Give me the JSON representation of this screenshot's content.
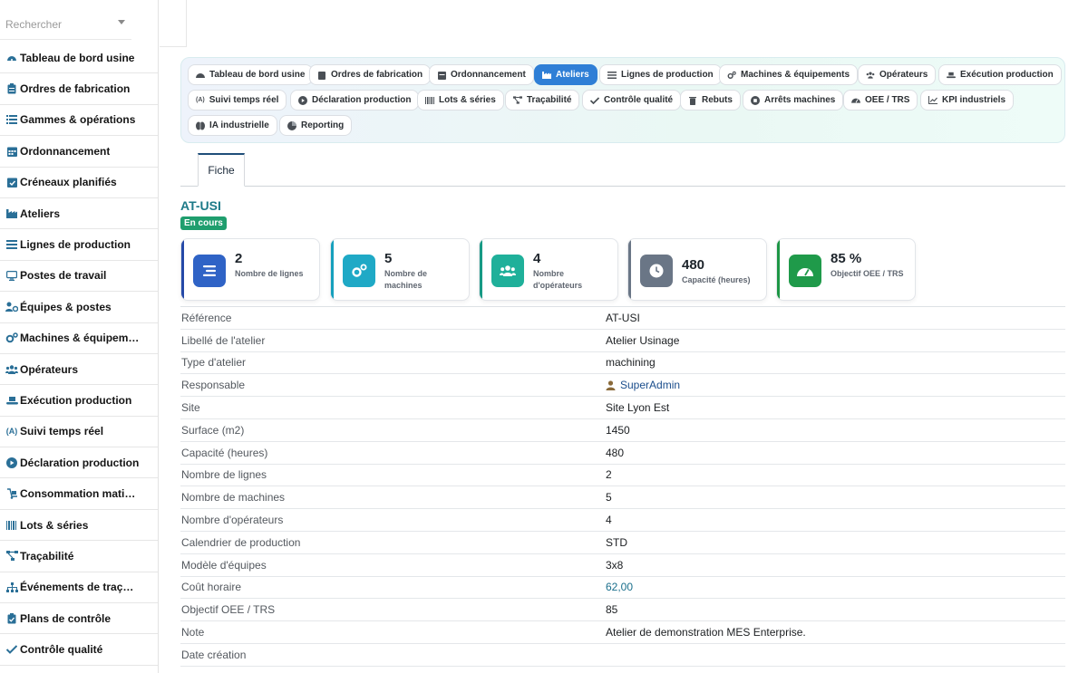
{
  "sidebar": {
    "search_placeholder": "Rechercher",
    "items": [
      {
        "label": "Tableau de bord usine",
        "icon": "dashboard-icon"
      },
      {
        "label": "Ordres de fabrication",
        "icon": "clipboard-icon"
      },
      {
        "label": "Gammes & opérations",
        "icon": "list-icon"
      },
      {
        "label": "Ordonnancement",
        "icon": "calendar-icon"
      },
      {
        "label": "Créneaux planifiés",
        "icon": "calendar-check-icon"
      },
      {
        "label": "Ateliers",
        "icon": "industry-icon"
      },
      {
        "label": "Lignes de production",
        "icon": "bars-icon"
      },
      {
        "label": "Postes de travail",
        "icon": "desktop-icon"
      },
      {
        "label": "Équipes & postes",
        "icon": "users-cog-icon"
      },
      {
        "label": "Machines & équipem…",
        "icon": "cogs-icon"
      },
      {
        "label": "Opérateurs",
        "icon": "users-icon"
      },
      {
        "label": "Exécution production",
        "icon": "conveyor-icon"
      },
      {
        "label": "Suivi temps réel",
        "icon": "broadcast-icon"
      },
      {
        "label": "Déclaration production",
        "icon": "play-circle-icon"
      },
      {
        "label": "Consommation mati…",
        "icon": "dolly-icon"
      },
      {
        "label": "Lots & séries",
        "icon": "barcode-icon"
      },
      {
        "label": "Traçabilité",
        "icon": "project-diagram-icon"
      },
      {
        "label": "Événements de traç…",
        "icon": "sitemap-icon"
      },
      {
        "label": "Plans de contrôle",
        "icon": "clipboard-check-icon"
      },
      {
        "label": "Contrôle qualité",
        "icon": "check-double-icon"
      }
    ]
  },
  "modules": [
    {
      "label": "Tableau de bord usine",
      "icon": "dashboard-icon"
    },
    {
      "label": "Ordres de fabrication",
      "icon": "clipboard-icon"
    },
    {
      "label": "Ordonnancement",
      "icon": "calendar-icon"
    },
    {
      "label": "Ateliers",
      "icon": "industry-icon",
      "active": true
    },
    {
      "label": "Lignes de production",
      "icon": "bars-icon"
    },
    {
      "label": "Machines & équipements",
      "icon": "cogs-icon"
    },
    {
      "label": "Opérateurs",
      "icon": "users-icon"
    },
    {
      "label": "Exécution production",
      "icon": "conveyor-icon"
    },
    {
      "label": "Suivi temps réel",
      "icon": "broadcast-icon"
    },
    {
      "label": "Déclaration production",
      "icon": "play-circle-icon"
    },
    {
      "label": "Lots & séries",
      "icon": "barcode-icon"
    },
    {
      "label": "Traçabilité",
      "icon": "project-diagram-icon"
    },
    {
      "label": "Contrôle qualité",
      "icon": "check-double-icon"
    },
    {
      "label": "Rebuts",
      "icon": "trash-icon"
    },
    {
      "label": "Arrêts machines",
      "icon": "stop-circle-icon"
    },
    {
      "label": "OEE / TRS",
      "icon": "gauge-icon"
    },
    {
      "label": "KPI industriels",
      "icon": "chart-line-icon"
    },
    {
      "label": "IA industrielle",
      "icon": "brain-icon"
    },
    {
      "label": "Reporting",
      "icon": "pie-chart-icon"
    }
  ],
  "tabs": {
    "fiche": "Fiche"
  },
  "record": {
    "title": "AT-USI",
    "status": "En cours"
  },
  "kpis": [
    {
      "value": "2",
      "label": "Nombre de lignes",
      "color": "#2f63c6",
      "stripe": "#2549a8",
      "icon": "list-icon"
    },
    {
      "value": "5",
      "label": "Nombre de machines",
      "color": "#1fa9c6",
      "stripe": "#16a0bd",
      "icon": "cogs-icon"
    },
    {
      "value": "4",
      "label": "Nombre d'opérateurs",
      "color": "#1fb09a",
      "stripe": "#179a85",
      "icon": "users-icon"
    },
    {
      "value": "480",
      "label": "Capacité (heures)",
      "color": "#6a7686",
      "stripe": "#6a7686",
      "icon": "clock-icon"
    },
    {
      "value": "85 %",
      "label": "Objectif OEE / TRS",
      "color": "#1f9a4a",
      "stripe": "#1c9544",
      "icon": "gauge-icon"
    }
  ],
  "details": [
    {
      "key": "Référence",
      "value": "AT-USI"
    },
    {
      "key": "Libellé de l'atelier",
      "value": "Atelier Usinage"
    },
    {
      "key": "Type d'atelier",
      "value": "machining"
    },
    {
      "key": "Responsable",
      "value": "SuperAdmin"
    },
    {
      "key": "Site",
      "value": "Site Lyon Est"
    },
    {
      "key": "Surface (m2)",
      "value": "1450"
    },
    {
      "key": "Capacité (heures)",
      "value": "480"
    },
    {
      "key": "Nombre de lignes",
      "value": "2"
    },
    {
      "key": "Nombre de machines",
      "value": "5"
    },
    {
      "key": "Nombre d'opérateurs",
      "value": "4"
    },
    {
      "key": "Calendrier de production",
      "value": "STD"
    },
    {
      "key": "Modèle d'équipes",
      "value": "3x8"
    },
    {
      "key": "Coût horaire",
      "value": "62,00"
    },
    {
      "key": "Objectif OEE / TRS",
      "value": "85"
    },
    {
      "key": "Note",
      "value": "Atelier de demonstration MES Enterprise."
    },
    {
      "key": "Date création",
      "value": ""
    }
  ]
}
